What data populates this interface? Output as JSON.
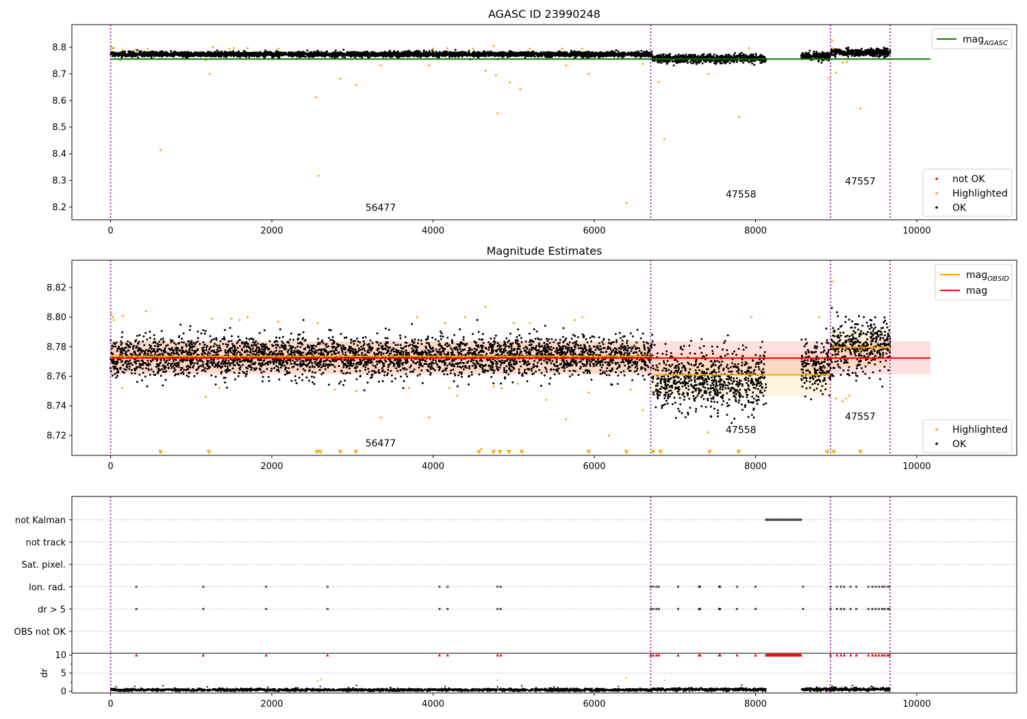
{
  "chart_data": [
    {
      "id": "p1",
      "type": "scatter",
      "title": "AGASC ID 23990248",
      "xlim": [
        -480,
        11240
      ],
      "ylim": [
        8.152,
        8.885
      ],
      "xticks": [
        0,
        2000,
        4000,
        6000,
        8000,
        10000
      ],
      "xtick_labels": [
        "0",
        "2000",
        "4000",
        "6000",
        "8000",
        "10000"
      ],
      "yticks": [
        8.2,
        8.3,
        8.4,
        8.5,
        8.6,
        8.7,
        8.8
      ],
      "ytick_labels": [
        "8.2",
        "8.3",
        "8.4",
        "8.5",
        "8.6",
        "8.7",
        "8.8"
      ],
      "obs_boundaries": [
        0,
        6700,
        8930,
        9670
      ],
      "obs_labels": [
        {
          "text": "56477",
          "x": 3350,
          "y": 8.185
        },
        {
          "text": "47558",
          "x": 7820,
          "y": 8.235
        },
        {
          "text": "47557",
          "x": 9300,
          "y": 8.285
        }
      ],
      "lines": [
        {
          "name": "mag",
          "subscript": "AGASC",
          "color": "#008000",
          "y": 8.7557,
          "x_range": [
            0,
            10170
          ]
        }
      ],
      "ok_segments": [
        {
          "x_range": [
            0,
            6720
          ],
          "mean": 8.774,
          "sd": 0.0045,
          "density": 1.6
        },
        {
          "x_range": [
            6720,
            8130
          ],
          "mean": 8.757,
          "sd": 0.0075,
          "density": 1.6
        },
        {
          "x_range": [
            8570,
            8930
          ],
          "mean": 8.767,
          "sd": 0.0075,
          "density": 1.6
        },
        {
          "x_range": [
            8930,
            9670
          ],
          "mean": 8.78,
          "sd": 0.007,
          "density": 1.6
        }
      ],
      "highlighted_points": [
        [
          10,
          8.801
        ],
        [
          25,
          8.797
        ],
        [
          40,
          8.796
        ],
        [
          120,
          8.752
        ],
        [
          150,
          8.79
        ],
        [
          310,
          8.79
        ],
        [
          460,
          8.793
        ],
        [
          620,
          8.415
        ],
        [
          1180,
          8.752
        ],
        [
          1230,
          8.7
        ],
        [
          1270,
          8.8
        ],
        [
          1470,
          8.795
        ],
        [
          1530,
          8.797
        ],
        [
          1700,
          8.797
        ],
        [
          2080,
          8.795
        ],
        [
          2550,
          8.612
        ],
        [
          2580,
          8.318
        ],
        [
          2850,
          8.682
        ],
        [
          3050,
          8.658
        ],
        [
          3350,
          8.732
        ],
        [
          3950,
          8.732
        ],
        [
          4000,
          8.795
        ],
        [
          4180,
          8.796
        ],
        [
          4500,
          8.795
        ],
        [
          4650,
          8.712
        ],
        [
          4750,
          8.805
        ],
        [
          4780,
          8.695
        ],
        [
          4800,
          8.552
        ],
        [
          4950,
          8.668
        ],
        [
          5080,
          8.643
        ],
        [
          5200,
          8.795
        ],
        [
          5600,
          8.795
        ],
        [
          5650,
          8.732
        ],
        [
          5850,
          8.795
        ],
        [
          5930,
          8.7
        ],
        [
          6400,
          8.215
        ],
        [
          6600,
          8.738
        ],
        [
          6800,
          8.67
        ],
        [
          6870,
          8.455
        ],
        [
          7420,
          8.7
        ],
        [
          7800,
          8.538
        ],
        [
          7920,
          8.797
        ],
        [
          8910,
          8.683
        ],
        [
          8950,
          8.825
        ],
        [
          8960,
          8.795
        ],
        [
          9000,
          8.705
        ],
        [
          9080,
          8.742
        ],
        [
          9130,
          8.745
        ],
        [
          9150,
          8.755
        ],
        [
          9300,
          8.57
        ]
      ],
      "legend_upper": [
        {
          "label": "mag",
          "subscript": "AGASC",
          "color": "#008000",
          "kind": "line"
        }
      ],
      "legend_lower": [
        {
          "label": "not OK",
          "color": "#ff0000",
          "kind": "point"
        },
        {
          "label": "Highlighted",
          "color": "#ffa500",
          "kind": "point"
        },
        {
          "label": "OK",
          "color": "#000000",
          "kind": "point"
        }
      ]
    },
    {
      "id": "p2",
      "type": "scatter",
      "title": "Magnitude Estimates",
      "xlim": [
        -480,
        11240
      ],
      "ylim": [
        8.7065,
        8.8385
      ],
      "xticks": [
        0,
        2000,
        4000,
        6000,
        8000,
        10000
      ],
      "xtick_labels": [
        "0",
        "2000",
        "4000",
        "6000",
        "8000",
        "10000"
      ],
      "yticks": [
        8.72,
        8.74,
        8.76,
        8.78,
        8.8,
        8.82
      ],
      "ytick_labels": [
        "8.72",
        "8.74",
        "8.76",
        "8.78",
        "8.80",
        "8.82"
      ],
      "obs_boundaries": [
        0,
        6700,
        8930,
        9670
      ],
      "obs_labels": [
        {
          "text": "56477",
          "x": 3350,
          "y": 8.7125
        },
        {
          "text": "47558",
          "x": 7820,
          "y": 8.7215
        },
        {
          "text": "47557",
          "x": 9300,
          "y": 8.7305
        }
      ],
      "bands": [
        {
          "x_range": [
            0,
            10170
          ],
          "y_range": [
            8.7613,
            8.7837
          ],
          "color": "#ff0000",
          "opacity": 0.12
        },
        {
          "x_range": [
            0,
            6720
          ],
          "y_range": [
            8.7625,
            8.7835
          ],
          "color": "#ffa500",
          "opacity": 0.12
        },
        {
          "x_range": [
            6720,
            8930
          ],
          "y_range": [
            8.7465,
            8.7755
          ],
          "color": "#ffa500",
          "opacity": 0.12
        },
        {
          "x_range": [
            8930,
            9670
          ],
          "y_range": [
            8.7665,
            8.7915
          ],
          "color": "#ffa500",
          "opacity": 0.12
        }
      ],
      "lines": [
        {
          "name": "mag",
          "color": "#ff0000",
          "y": 8.7723,
          "x_range": [
            0,
            10170
          ]
        },
        {
          "name": "mag",
          "subscript": "OBSID",
          "color": "#ffa500",
          "y": 8.7735,
          "x_range": [
            0,
            6720
          ]
        },
        {
          "name": "mag",
          "subscript": "OBSID",
          "color": "#ffa500",
          "y": 8.761,
          "x_range": [
            6720,
            8930
          ]
        },
        {
          "name": "mag",
          "subscript": "OBSID",
          "color": "#ffa500",
          "y": 8.7795,
          "x_range": [
            8930,
            9670
          ]
        }
      ],
      "ok_segments": [
        {
          "x_range": [
            0,
            6720
          ],
          "mean": 8.7735,
          "sd": 0.0065,
          "density": 1.6
        },
        {
          "x_range": [
            6720,
            8130
          ],
          "mean": 8.757,
          "sd": 0.0095,
          "density": 1.6
        },
        {
          "x_range": [
            8570,
            8930
          ],
          "mean": 8.767,
          "sd": 0.009,
          "density": 1.6
        },
        {
          "x_range": [
            8930,
            9670
          ],
          "mean": 8.781,
          "sd": 0.009,
          "density": 1.6
        }
      ],
      "highlighted_points": [
        [
          10,
          8.802
        ],
        [
          25,
          8.8
        ],
        [
          40,
          8.798
        ],
        [
          140,
          8.752
        ],
        [
          150,
          8.801
        ],
        [
          440,
          8.804
        ],
        [
          1180,
          8.746
        ],
        [
          1260,
          8.799
        ],
        [
          1350,
          8.752
        ],
        [
          1500,
          8.799
        ],
        [
          1600,
          8.798
        ],
        [
          1700,
          8.8
        ],
        [
          2080,
          8.797
        ],
        [
          2570,
          8.796
        ],
        [
          2780,
          8.751
        ],
        [
          3050,
          8.75
        ],
        [
          3350,
          8.732
        ],
        [
          3700,
          8.752
        ],
        [
          3800,
          8.8
        ],
        [
          3950,
          8.732
        ],
        [
          4150,
          8.796
        ],
        [
          4200,
          8.752
        ],
        [
          4300,
          8.747
        ],
        [
          4400,
          8.8
        ],
        [
          4600,
          8.711
        ],
        [
          4650,
          8.807
        ],
        [
          4750,
          8.753
        ],
        [
          4850,
          8.752
        ],
        [
          5000,
          8.796
        ],
        [
          5050,
          8.755
        ],
        [
          5200,
          8.796
        ],
        [
          5400,
          8.744
        ],
        [
          5650,
          8.731
        ],
        [
          5760,
          8.798
        ],
        [
          5850,
          8.8
        ],
        [
          5930,
          8.749
        ],
        [
          6180,
          8.72
        ],
        [
          6450,
          8.751
        ],
        [
          6600,
          8.737
        ],
        [
          6700,
          8.752
        ],
        [
          7410,
          8.722
        ],
        [
          7950,
          8.8
        ],
        [
          8790,
          8.8
        ],
        [
          8950,
          8.824
        ],
        [
          9000,
          8.745
        ],
        [
          9080,
          8.743
        ],
        [
          9120,
          8.745
        ],
        [
          9160,
          8.747
        ]
      ],
      "below_axis_markers": [
        [
          620,
          8.7087
        ],
        [
          1220,
          8.7087
        ],
        [
          2560,
          8.7087
        ],
        [
          2600,
          8.7087
        ],
        [
          2850,
          8.7087
        ],
        [
          3040,
          8.7087
        ],
        [
          4570,
          8.7087
        ],
        [
          4750,
          8.7087
        ],
        [
          4830,
          8.7087
        ],
        [
          4940,
          8.7087
        ],
        [
          5100,
          8.7087
        ],
        [
          5930,
          8.7087
        ],
        [
          6400,
          8.7087
        ],
        [
          6730,
          8.7087
        ],
        [
          6820,
          8.7087
        ],
        [
          7430,
          8.7087
        ],
        [
          7790,
          8.7087
        ],
        [
          8890,
          8.7087
        ],
        [
          8970,
          8.7087
        ],
        [
          9300,
          8.7087
        ]
      ],
      "legend_upper": [
        {
          "label": "mag",
          "subscript": "OBSID",
          "color": "#ffa500",
          "kind": "line"
        },
        {
          "label": "mag",
          "subscript": "",
          "color": "#ff0000",
          "kind": "line"
        }
      ],
      "legend_lower": [
        {
          "label": "Highlighted",
          "color": "#ffa500",
          "kind": "point"
        },
        {
          "label": "OK",
          "color": "#000000",
          "kind": "point"
        }
      ]
    },
    {
      "id": "p3",
      "type": "scatter",
      "xlim": [
        -480,
        11240
      ],
      "flag_labels": [
        "not Kalman",
        "not track",
        "Sat. pixel.",
        "Ion. rad.",
        "dr > 5",
        "OBS not OK"
      ],
      "flags": {
        "not Kalman": {
          "ranges": [
            [
              8130,
              8570
            ]
          ],
          "points": []
        },
        "not track": {
          "ranges": [],
          "points": []
        },
        "Sat. pixel.": {
          "ranges": [],
          "points": []
        },
        "Ion. rad.": {
          "ranges": [],
          "points": [
            320,
            1150,
            1930,
            2690,
            4080,
            4180,
            4800,
            4840,
            6700,
            6730,
            6770,
            6800,
            7040,
            7300,
            7310,
            7550,
            7560,
            7770,
            8000,
            8590,
            8930,
            9010,
            9060,
            9100,
            9180,
            9250,
            9400,
            9450,
            9490,
            9530,
            9570,
            9600,
            9640,
            9660
          ]
        },
        "dr > 5": {
          "ranges": [],
          "points": [
            320,
            1150,
            1930,
            2690,
            4080,
            4180,
            4800,
            4840,
            6700,
            6730,
            6770,
            6800,
            7040,
            7300,
            7310,
            7550,
            7560,
            7770,
            8000,
            8590,
            8930,
            9010,
            9060,
            9100,
            9180,
            9250,
            9400,
            9450,
            9490,
            9530,
            9570,
            9600,
            9640,
            9660
          ]
        },
        "OBS not OK": {
          "ranges": [],
          "points": []
        }
      }
    },
    {
      "id": "p4",
      "type": "scatter",
      "xlim": [
        -480,
        11240
      ],
      "ylim": [
        -0.5,
        10.5
      ],
      "xticks": [
        0,
        2000,
        4000,
        6000,
        8000,
        10000
      ],
      "xtick_labels": [
        "0",
        "2000",
        "4000",
        "6000",
        "8000",
        "10000"
      ],
      "yticks": [
        0,
        5,
        10
      ],
      "ytick_labels": [
        "0",
        "5",
        "10"
      ],
      "ylabel": "dr",
      "obs_boundaries": [
        0,
        6700,
        8930,
        9670
      ],
      "ok_segments": [
        {
          "x_range": [
            0,
            6720
          ],
          "mean": 0.35,
          "sd": 0.18,
          "density": 1.0
        },
        {
          "x_range": [
            6720,
            8130
          ],
          "mean": 0.45,
          "sd": 0.2,
          "density": 1.0
        },
        {
          "x_range": [
            8570,
            9670
          ],
          "mean": 0.5,
          "sd": 0.22,
          "density": 1.0
        }
      ],
      "scatter_extra": [
        [
          70,
          1.2
        ],
        [
          300,
          1.3
        ],
        [
          650,
          1.5
        ],
        [
          1200,
          1.2
        ],
        [
          1950,
          1.1
        ],
        [
          2600,
          1.3
        ],
        [
          3050,
          1.6
        ],
        [
          4150,
          1.3
        ],
        [
          4800,
          1.2
        ],
        [
          5100,
          1.5
        ],
        [
          5500,
          1.2
        ],
        [
          6300,
          1.3
        ],
        [
          7830,
          1.7
        ],
        [
          8950,
          1.4
        ],
        [
          9200,
          1.6
        ],
        [
          9450,
          1.2
        ]
      ],
      "highlighted_points": [
        [
          2570,
          2.9
        ],
        [
          2610,
          3.2
        ],
        [
          4800,
          3.0
        ],
        [
          6400,
          3.7
        ],
        [
          6870,
          3.0
        ],
        [
          8890,
          2.8
        ]
      ],
      "clipped_markers": {
        "ranges": [
          [
            8130,
            8570
          ]
        ],
        "points": [
          320,
          1150,
          1930,
          2690,
          4080,
          4180,
          4800,
          4840,
          6700,
          6730,
          6770,
          6800,
          7040,
          7300,
          7310,
          7550,
          7560,
          7770,
          8000,
          8930,
          9010,
          9060,
          9100,
          9180,
          9250,
          9400,
          9450,
          9490,
          9530,
          9570,
          9600,
          9640,
          9660
        ]
      }
    }
  ]
}
